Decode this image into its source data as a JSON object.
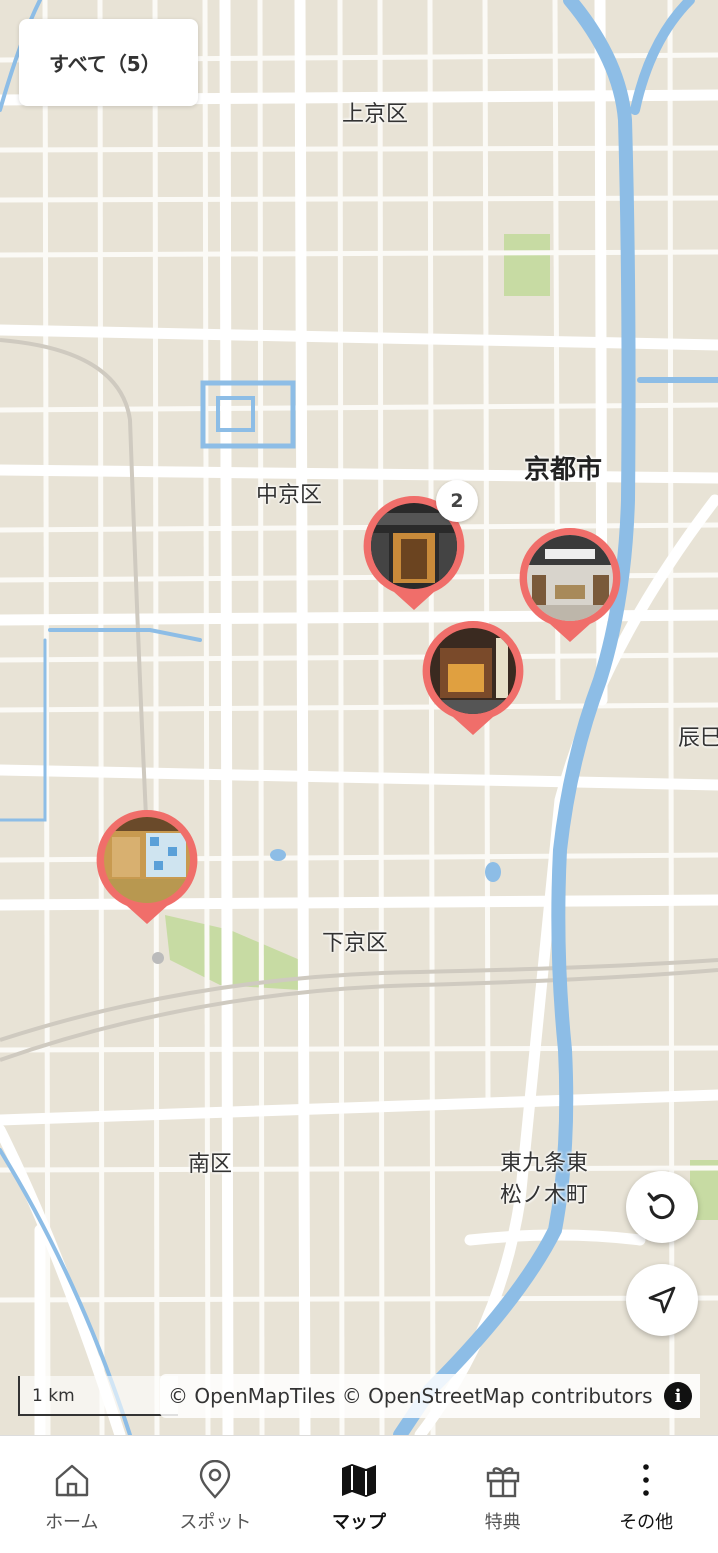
{
  "filter": {
    "label": "すべて（5）"
  },
  "map": {
    "district_labels": [
      "上京区",
      "京都市",
      "中京区",
      "辰巳",
      "下京区",
      "南区",
      "東九条東",
      "松ノ木町"
    ],
    "scale_label": "1 km",
    "attribution": "© OpenMapTiles © OpenStreetMap contributors",
    "info_label": "i"
  },
  "markers": [
    {
      "name": "spot-cluster",
      "badge": "2"
    },
    {
      "name": "spot-bookstore"
    },
    {
      "name": "spot-shop"
    },
    {
      "name": "spot-tearoom"
    }
  ],
  "controls": [
    "reset-view",
    "current-location"
  ],
  "tabbar": {
    "items": [
      {
        "label": "ホーム",
        "icon": "home-icon",
        "active": false
      },
      {
        "label": "スポット",
        "icon": "location-pin-icon",
        "active": false
      },
      {
        "label": "マップ",
        "icon": "map-icon",
        "active": true
      },
      {
        "label": "特典",
        "icon": "gift-icon",
        "active": false
      },
      {
        "label": "その他",
        "icon": "more-vertical-icon",
        "active": false
      }
    ]
  },
  "colors": {
    "pin": "#f06e6a",
    "water": "#8dbde6",
    "road": "#ffffff",
    "land": "#e8e3d6",
    "park": "#c7dba3"
  }
}
